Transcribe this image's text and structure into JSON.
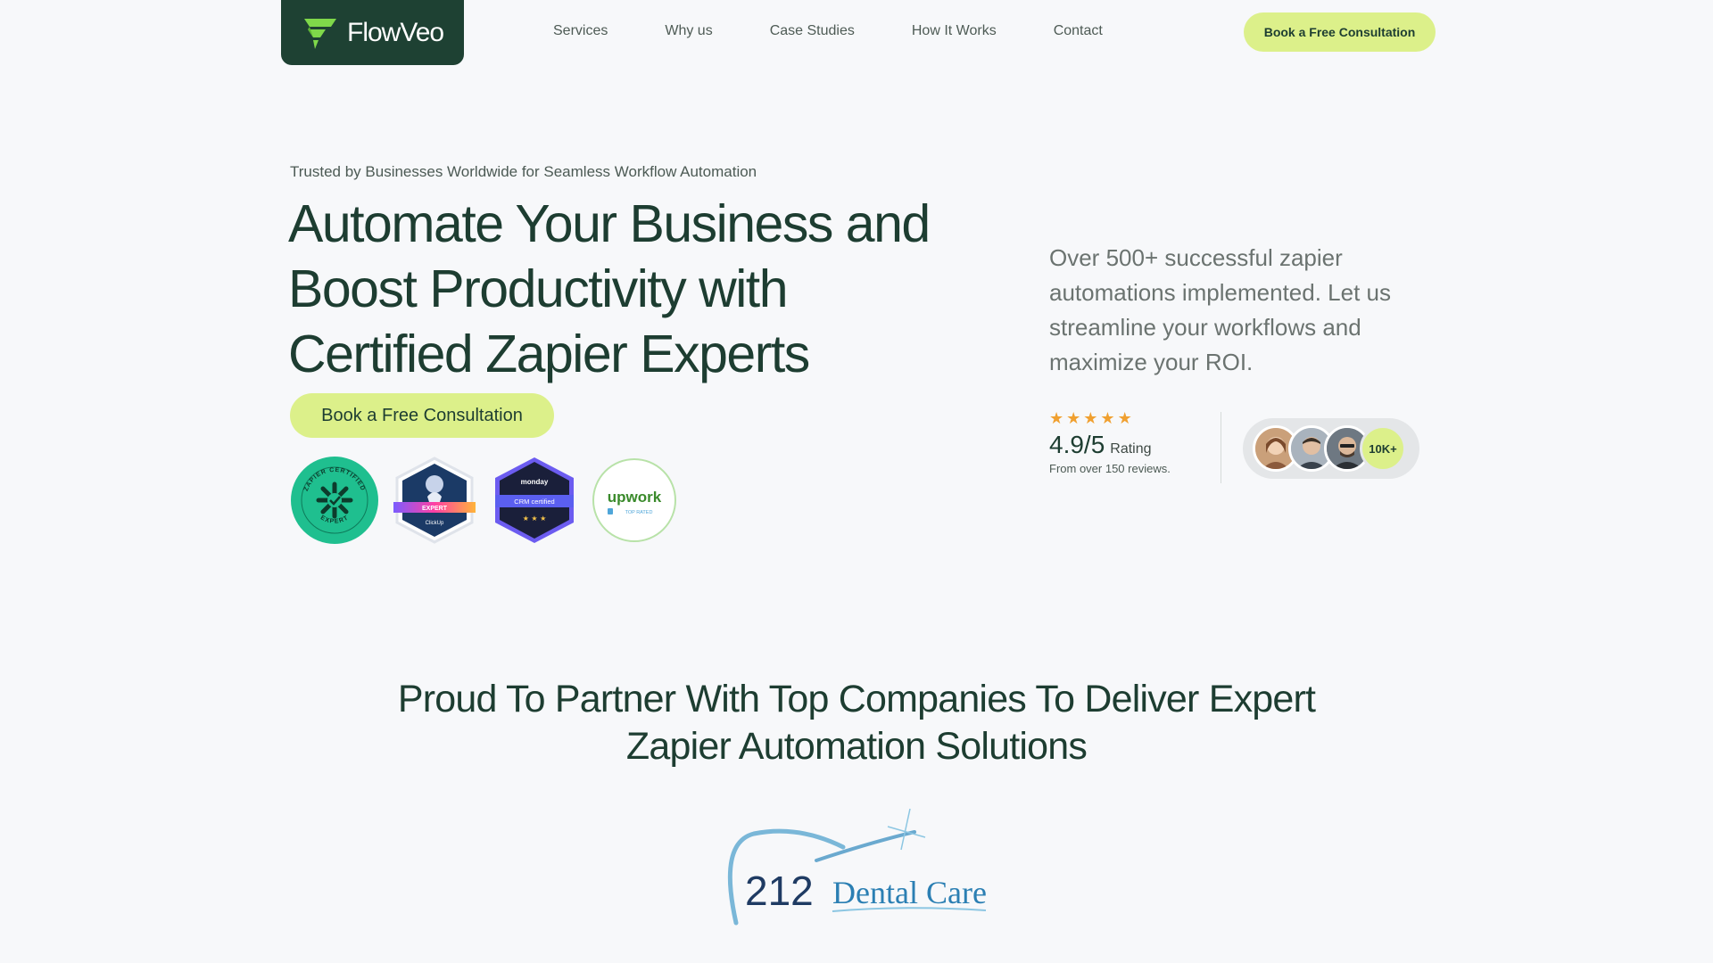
{
  "brand": {
    "name": "FlowVeo"
  },
  "nav": {
    "items": [
      "Services",
      "Why us",
      "Case Studies",
      "How It Works",
      "Contact"
    ],
    "cta": "Book a Free Consultation"
  },
  "hero": {
    "trust_line": "Trusted by Businesses Worldwide for Seamless Workflow Automation",
    "title": "Automate Your Business and Boost Productivity with Certified Zapier Experts",
    "cta": "Book a Free Consultation",
    "description": "Over 500+ successful zapier automations implemented. Let us streamline your workflows and maximize your ROI.",
    "badges": {
      "zapier": {
        "top": "ZAPIER CERTIFIED",
        "bottom": "EXPERT"
      },
      "clickup": {
        "label": "EXPERT",
        "brand": "ClickUp"
      },
      "monday": {
        "brand": "monday",
        "label": "CRM certified",
        "stars": "★ ★ ★"
      },
      "upwork": {
        "brand": "upwork",
        "label": "TOP RATED"
      }
    }
  },
  "rating": {
    "stars": 5,
    "value": "4.9/5",
    "label": "Rating",
    "sub": "From over 150 reviews.",
    "count": "10K+"
  },
  "partners": {
    "title": "Proud To Partner With Top Companies To Deliver Expert Zapier Automation Solutions",
    "logo": {
      "number": "212",
      "name": "Dental Care"
    }
  },
  "colors": {
    "primary_dark": "#1e4133",
    "accent_lime": "#dcf08a",
    "star": "#f0a030",
    "zapier_teal": "#1fbf8f"
  }
}
